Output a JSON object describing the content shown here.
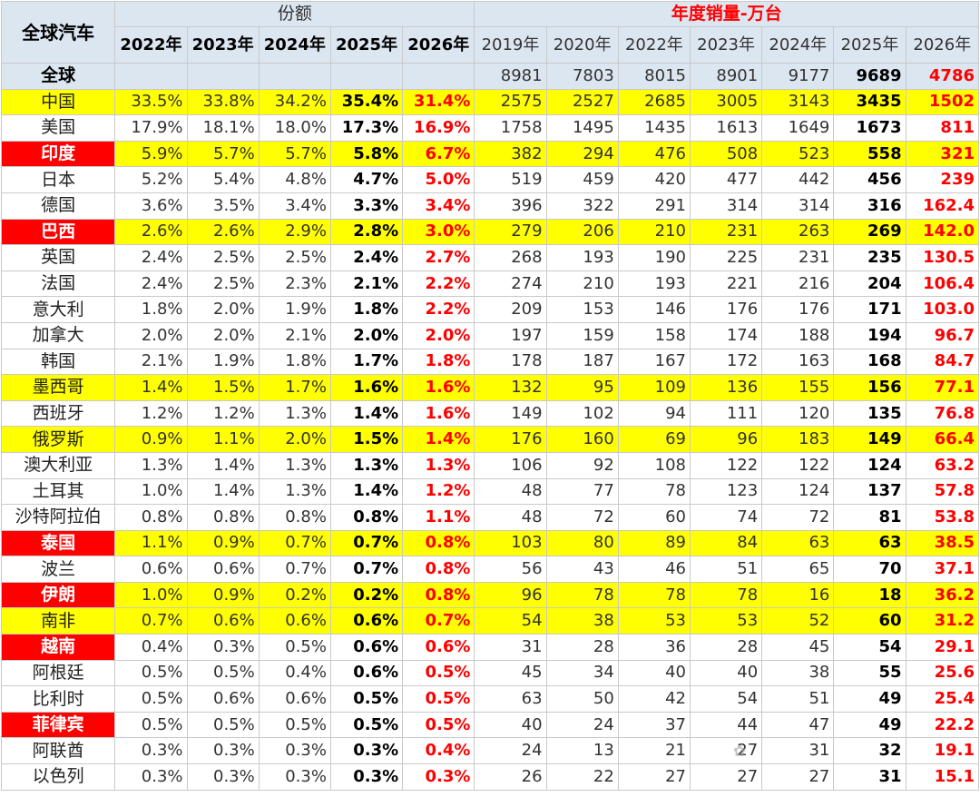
{
  "table": {
    "corner_label": "全球汽车",
    "share_group_label": "份额",
    "sales_group_label": "年度销量-万台",
    "share_years": [
      "2022年",
      "2023年",
      "2024年",
      "2025年",
      "2026年"
    ],
    "sales_years": [
      "2019年",
      "2020年",
      "2022年",
      "2023年",
      "2024年",
      "2025年",
      "2026年"
    ],
    "total_row": {
      "name": "全球",
      "shares": [
        "",
        "",
        "",
        "",
        ""
      ],
      "sales": [
        "8981",
        "7803",
        "8015",
        "8901",
        "9177",
        "9689",
        "4786"
      ]
    },
    "rows": [
      {
        "name": "中国",
        "highlight": true,
        "tag": false,
        "shares": [
          "33.5%",
          "33.8%",
          "34.2%",
          "35.4%",
          "31.4%"
        ],
        "sales": [
          "2575",
          "2527",
          "2685",
          "3005",
          "3143",
          "3435",
          "1502"
        ]
      },
      {
        "name": "美国",
        "highlight": false,
        "tag": false,
        "shares": [
          "17.9%",
          "18.1%",
          "18.0%",
          "17.3%",
          "16.9%"
        ],
        "sales": [
          "1758",
          "1495",
          "1435",
          "1613",
          "1649",
          "1673",
          "811"
        ]
      },
      {
        "name": "印度",
        "highlight": true,
        "tag": true,
        "shares": [
          "5.9%",
          "5.7%",
          "5.7%",
          "5.8%",
          "6.7%"
        ],
        "sales": [
          "382",
          "294",
          "476",
          "508",
          "523",
          "558",
          "321"
        ]
      },
      {
        "name": "日本",
        "highlight": false,
        "tag": false,
        "shares": [
          "5.2%",
          "5.4%",
          "4.8%",
          "4.7%",
          "5.0%"
        ],
        "sales": [
          "519",
          "459",
          "420",
          "477",
          "442",
          "456",
          "239"
        ]
      },
      {
        "name": "德国",
        "highlight": false,
        "tag": false,
        "shares": [
          "3.6%",
          "3.5%",
          "3.4%",
          "3.3%",
          "3.4%"
        ],
        "sales": [
          "396",
          "322",
          "291",
          "314",
          "314",
          "316",
          "162.4"
        ]
      },
      {
        "name": "巴西",
        "highlight": true,
        "tag": true,
        "shares": [
          "2.6%",
          "2.6%",
          "2.9%",
          "2.8%",
          "3.0%"
        ],
        "sales": [
          "279",
          "206",
          "210",
          "231",
          "263",
          "269",
          "142.0"
        ]
      },
      {
        "name": "英国",
        "highlight": false,
        "tag": false,
        "shares": [
          "2.4%",
          "2.5%",
          "2.5%",
          "2.4%",
          "2.7%"
        ],
        "sales": [
          "268",
          "193",
          "190",
          "225",
          "231",
          "235",
          "130.5"
        ]
      },
      {
        "name": "法国",
        "highlight": false,
        "tag": false,
        "shares": [
          "2.4%",
          "2.5%",
          "2.3%",
          "2.1%",
          "2.2%"
        ],
        "sales": [
          "274",
          "210",
          "193",
          "221",
          "216",
          "204",
          "106.4"
        ]
      },
      {
        "name": "意大利",
        "highlight": false,
        "tag": false,
        "shares": [
          "1.8%",
          "2.0%",
          "1.9%",
          "1.8%",
          "2.2%"
        ],
        "sales": [
          "209",
          "153",
          "146",
          "176",
          "176",
          "171",
          "103.0"
        ]
      },
      {
        "name": "加拿大",
        "highlight": false,
        "tag": false,
        "shares": [
          "2.0%",
          "2.0%",
          "2.1%",
          "2.0%",
          "2.0%"
        ],
        "sales": [
          "197",
          "159",
          "158",
          "174",
          "188",
          "194",
          "96.7"
        ]
      },
      {
        "name": "韩国",
        "highlight": false,
        "tag": false,
        "shares": [
          "2.1%",
          "1.9%",
          "1.8%",
          "1.7%",
          "1.8%"
        ],
        "sales": [
          "178",
          "187",
          "167",
          "172",
          "163",
          "168",
          "84.7"
        ]
      },
      {
        "name": "墨西哥",
        "highlight": true,
        "tag": false,
        "shares": [
          "1.4%",
          "1.5%",
          "1.7%",
          "1.6%",
          "1.6%"
        ],
        "sales": [
          "132",
          "95",
          "109",
          "136",
          "155",
          "156",
          "77.1"
        ]
      },
      {
        "name": "西班牙",
        "highlight": false,
        "tag": false,
        "shares": [
          "1.2%",
          "1.2%",
          "1.3%",
          "1.4%",
          "1.6%"
        ],
        "sales": [
          "149",
          "102",
          "94",
          "111",
          "120",
          "135",
          "76.8"
        ]
      },
      {
        "name": "俄罗斯",
        "highlight": true,
        "tag": false,
        "shares": [
          "0.9%",
          "1.1%",
          "2.0%",
          "1.5%",
          "1.4%"
        ],
        "sales": [
          "176",
          "160",
          "69",
          "96",
          "183",
          "149",
          "66.4"
        ]
      },
      {
        "name": "澳大利亚",
        "highlight": false,
        "tag": false,
        "shares": [
          "1.3%",
          "1.4%",
          "1.3%",
          "1.3%",
          "1.3%"
        ],
        "sales": [
          "106",
          "92",
          "108",
          "122",
          "122",
          "124",
          "63.2"
        ]
      },
      {
        "name": "土耳其",
        "highlight": false,
        "tag": false,
        "shares": [
          "1.0%",
          "1.4%",
          "1.3%",
          "1.4%",
          "1.2%"
        ],
        "sales": [
          "48",
          "77",
          "78",
          "123",
          "124",
          "137",
          "57.8"
        ]
      },
      {
        "name": "沙特阿拉伯",
        "highlight": false,
        "tag": false,
        "shares": [
          "0.8%",
          "0.8%",
          "0.8%",
          "0.8%",
          "1.1%"
        ],
        "sales": [
          "48",
          "72",
          "60",
          "74",
          "72",
          "81",
          "53.8"
        ]
      },
      {
        "name": "泰国",
        "highlight": true,
        "tag": true,
        "shares": [
          "1.1%",
          "0.9%",
          "0.7%",
          "0.7%",
          "0.8%"
        ],
        "sales": [
          "103",
          "80",
          "89",
          "84",
          "63",
          "63",
          "38.5"
        ]
      },
      {
        "name": "波兰",
        "highlight": false,
        "tag": false,
        "shares": [
          "0.6%",
          "0.6%",
          "0.7%",
          "0.7%",
          "0.8%"
        ],
        "sales": [
          "56",
          "43",
          "46",
          "51",
          "65",
          "70",
          "37.1"
        ]
      },
      {
        "name": "伊朗",
        "highlight": true,
        "tag": true,
        "shares": [
          "1.0%",
          "0.9%",
          "0.2%",
          "0.2%",
          "0.8%"
        ],
        "sales": [
          "96",
          "78",
          "78",
          "78",
          "16",
          "18",
          "36.2"
        ]
      },
      {
        "name": "南非",
        "highlight": true,
        "tag": false,
        "shares": [
          "0.7%",
          "0.6%",
          "0.6%",
          "0.6%",
          "0.7%"
        ],
        "sales": [
          "54",
          "38",
          "53",
          "53",
          "52",
          "60",
          "31.2"
        ]
      },
      {
        "name": "越南",
        "highlight": false,
        "tag": true,
        "shares": [
          "0.4%",
          "0.3%",
          "0.5%",
          "0.6%",
          "0.6%"
        ],
        "sales": [
          "31",
          "28",
          "36",
          "28",
          "45",
          "54",
          "29.1"
        ]
      },
      {
        "name": "阿根廷",
        "highlight": false,
        "tag": false,
        "shares": [
          "0.5%",
          "0.5%",
          "0.4%",
          "0.6%",
          "0.5%"
        ],
        "sales": [
          "45",
          "34",
          "40",
          "40",
          "38",
          "55",
          "25.6"
        ]
      },
      {
        "name": "比利时",
        "highlight": false,
        "tag": false,
        "shares": [
          "0.5%",
          "0.6%",
          "0.6%",
          "0.5%",
          "0.5%"
        ],
        "sales": [
          "63",
          "50",
          "42",
          "54",
          "51",
          "49",
          "25.4"
        ]
      },
      {
        "name": "菲律宾",
        "highlight": false,
        "tag": true,
        "shares": [
          "0.5%",
          "0.5%",
          "0.5%",
          "0.5%",
          "0.5%"
        ],
        "sales": [
          "40",
          "24",
          "37",
          "44",
          "47",
          "49",
          "22.2"
        ]
      },
      {
        "name": "阿联酋",
        "highlight": false,
        "tag": false,
        "shares": [
          "0.3%",
          "0.3%",
          "0.3%",
          "0.3%",
          "0.4%"
        ],
        "sales": [
          "24",
          "13",
          "21",
          "27",
          "31",
          "32",
          "19.1"
        ]
      },
      {
        "name": "以色列",
        "highlight": false,
        "tag": false,
        "shares": [
          "0.3%",
          "0.3%",
          "0.3%",
          "0.3%",
          "0.3%"
        ],
        "sales": [
          "26",
          "22",
          "27",
          "27",
          "27",
          "31",
          "15.1"
        ]
      }
    ]
  },
  "colors": {
    "header_bg": "#dce6f1",
    "highlight_bg": "#ffff00",
    "tag_bg": "#ff0000",
    "emphasis_red": "#ff0000",
    "grid": "#c9c9c9"
  }
}
